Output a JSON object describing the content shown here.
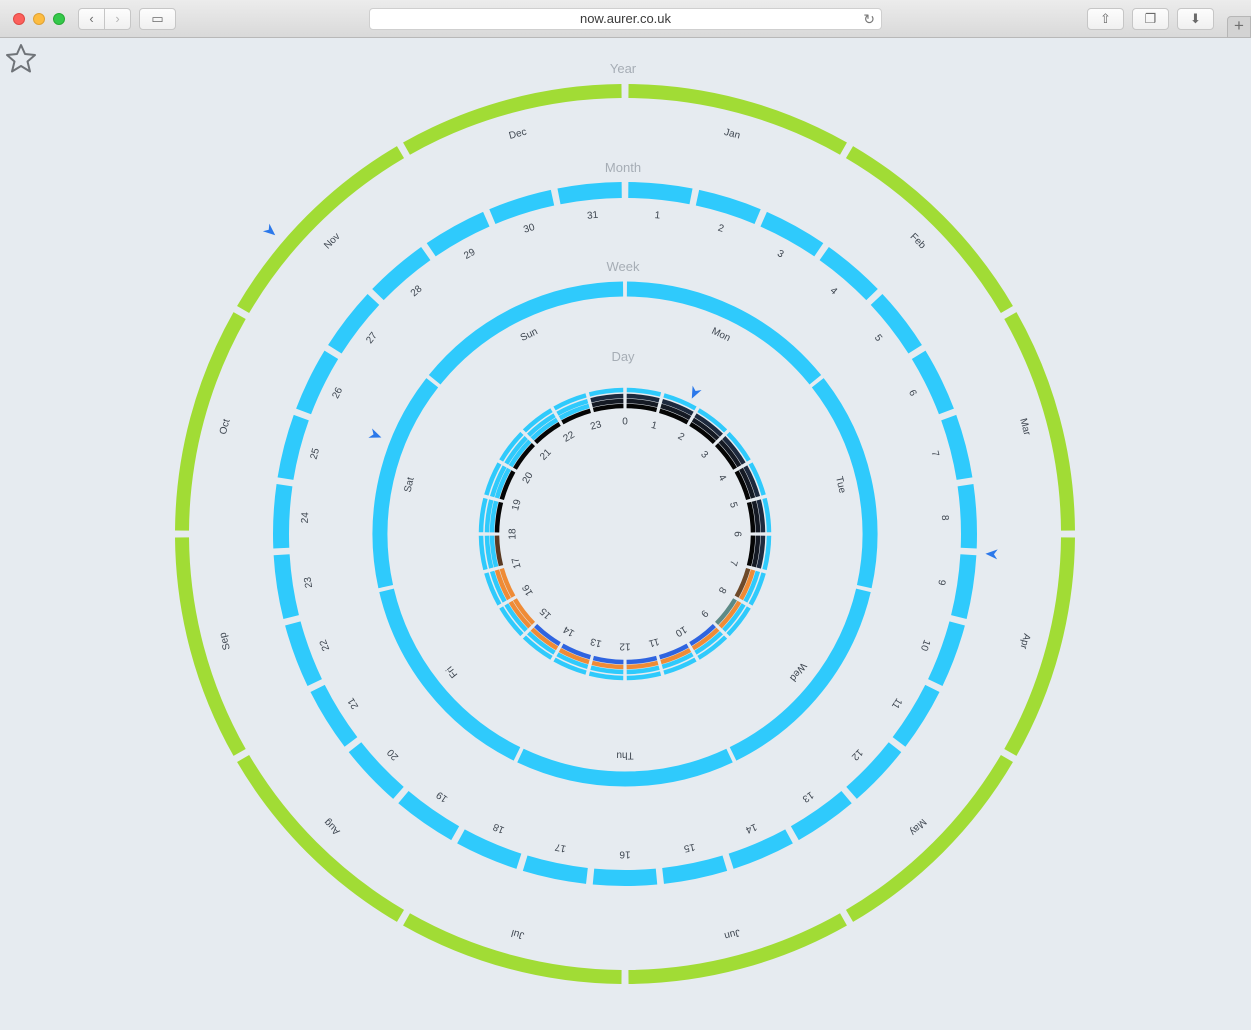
{
  "browser": {
    "url": "now.aurer.co.uk",
    "back_icon": "‹",
    "forward_icon": "›",
    "sidebar_icon": "▭",
    "share_icon": "⇧",
    "tabs_icon": "❐",
    "download_icon": "⬇",
    "newtab_icon": "+",
    "reload_icon": "↻"
  },
  "clock": {
    "rings": {
      "year": {
        "title": "Year",
        "labels": [
          "Jan",
          "Feb",
          "Mar",
          "Apr",
          "May",
          "Jun",
          "Jul",
          "Aug",
          "Sep",
          "Oct",
          "Nov",
          "Dec"
        ],
        "color": "#a1dc35",
        "current_index": 10
      },
      "month": {
        "title": "Month",
        "labels": [
          "1",
          "2",
          "3",
          "4",
          "5",
          "6",
          "7",
          "8",
          "9",
          "10",
          "11",
          "12",
          "13",
          "14",
          "15",
          "16",
          "17",
          "18",
          "19",
          "20",
          "21",
          "22",
          "23",
          "24",
          "25",
          "26",
          "27",
          "28",
          "29",
          "30",
          "31"
        ],
        "color": "#2fcafc",
        "current_index": 8
      },
      "week": {
        "title": "Week",
        "labels": [
          "Mon",
          "Tue",
          "Wed",
          "Thu",
          "Fri",
          "Sat",
          "Sun"
        ],
        "color": "#2fcafc",
        "current_index": 5
      },
      "day": {
        "title": "Day",
        "labels": [
          "0",
          "1",
          "2",
          "3",
          "4",
          "5",
          "6",
          "7",
          "8",
          "9",
          "10",
          "11",
          "12",
          "13",
          "14",
          "15",
          "16",
          "17",
          "18",
          "19",
          "20",
          "21",
          "22",
          "23"
        ],
        "current_index": 1
      }
    },
    "day_bands": [
      [
        "#2fcafc",
        "#2fcafc",
        "#2fcafc",
        "#2fcafc",
        "#2fcafc",
        "#2fcafc",
        "#2fcafc",
        "#2fcafc",
        "#2fcafc",
        "#2fcafc",
        "#2fcafc",
        "#2fcafc",
        "#2fcafc",
        "#2fcafc",
        "#2fcafc",
        "#2fcafc",
        "#2fcafc",
        "#2fcafc",
        "#2fcafc",
        "#2fcafc",
        "#2fcafc",
        "#2fcafc",
        "#2fcafc",
        "#2fcafc"
      ],
      [
        "#1e2a3e",
        "#1e2a3e",
        "#1e2a3e",
        "#1e2a3e",
        "#1e2a3e",
        "#1e2a3e",
        "#1e2a3e",
        "#2fcafc",
        "#2fcafc",
        "#2fcafc",
        "#2fcafc",
        "#2fcafc",
        "#2fcafc",
        "#2fcafc",
        "#2fcafc",
        "#2fcafc",
        "#2fcafc",
        "#2fcafc",
        "#2fcafc",
        "#2fcafc",
        "#2fcafc",
        "#2fcafc",
        "#2fcafc",
        "#1e2a3e"
      ],
      [
        "#151a24",
        "#151a24",
        "#151a24",
        "#151a24",
        "#151a24",
        "#151a24",
        "#151a24",
        "#ef8b36",
        "#ef8b36",
        "#ef8b36",
        "#ef8b36",
        "#ef8b36",
        "#ef8b36",
        "#ef8b36",
        "#ef8b36",
        "#ef8b36",
        "#ef8b36",
        "#2fcafc",
        "#2fcafc",
        "#2fcafc",
        "#2fcafc",
        "#2fcafc",
        "#2fcafc",
        "#151a24"
      ],
      [
        "#050505",
        "#050505",
        "#050505",
        "#050505",
        "#050505",
        "#050505",
        "#050505",
        "#6e4a2a",
        "#5d8a86",
        "#2f64e0",
        "#2f64e0",
        "#2f64e0",
        "#2f64e0",
        "#2f64e0",
        "#2f64e0",
        "#ef8b36",
        "#ef8b36",
        "#5a3a22",
        "#050505",
        "#050505",
        "#050505",
        "#050505",
        "#050505",
        "#050505"
      ]
    ],
    "marker_color": "#2b78ea"
  }
}
